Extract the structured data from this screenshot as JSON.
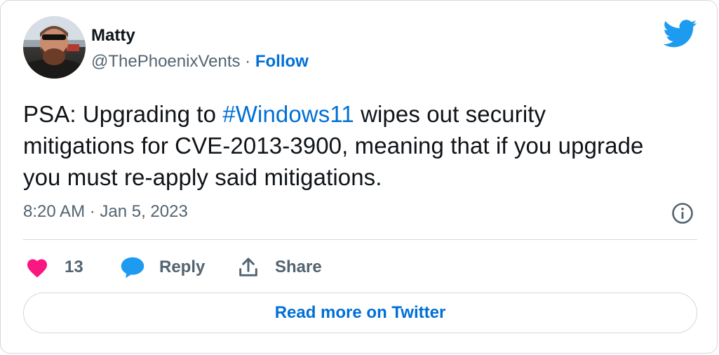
{
  "user": {
    "name": "Matty",
    "handle": "@ThePhoenixVents",
    "separator": " · ",
    "follow_label": "Follow"
  },
  "tweet": {
    "text_before": "PSA: Upgrading to ",
    "hashtag": "#Windows11",
    "text_after": " wipes out security mitigations for CVE-2013-3900, meaning that if you upgrade you must re-apply said mitigations.",
    "timestamp": "8:20 AM · Jan 5, 2023"
  },
  "actions": {
    "like_count": "13",
    "reply_label": "Reply",
    "share_label": "Share"
  },
  "footer": {
    "read_more_label": "Read more on Twitter"
  },
  "icons": {
    "bird": "twitter-bird-icon",
    "info": "info-icon",
    "heart": "heart-icon",
    "reply": "speech-bubble-icon",
    "share": "share-arrow-icon"
  },
  "colors": {
    "brand_blue": "#1d9bf0",
    "link_blue": "#006fd6",
    "heart_pink": "#f91880",
    "muted_gray": "#536471",
    "text_dark": "#0f1419",
    "border": "#cfd9de"
  }
}
